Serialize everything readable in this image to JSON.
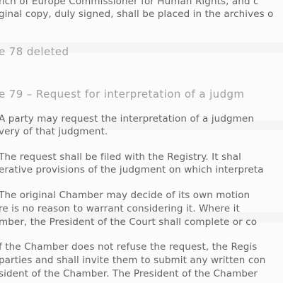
{
  "document": {
    "top_lines": [
      "nch of Europe Commissioner for Human Rights, and c",
      "ginal copy, duly signed, shall be placed in the archives o"
    ],
    "heading_deleted": "e 78 deleted",
    "heading_rule79": "e 79 – Request for interpretation of a judgm",
    "paragraphs": [
      [
        "A party may request the interpretation of a judgmen",
        "very of that judgment."
      ],
      [
        "The request shall be filed with the Registry. It shal",
        "erative provisions of the judgment on which interpreta"
      ],
      [
        "The original Chamber may decide of its own motion",
        "re is no reason to warrant considering it. Where it",
        "mber, the President of the Court shall complete or co"
      ],
      [
        "f the Chamber does not refuse the request, the Regis",
        "parties and shall invite them to submit any written con",
        "sident of the Chamber. The President of the Chamber"
      ]
    ]
  }
}
